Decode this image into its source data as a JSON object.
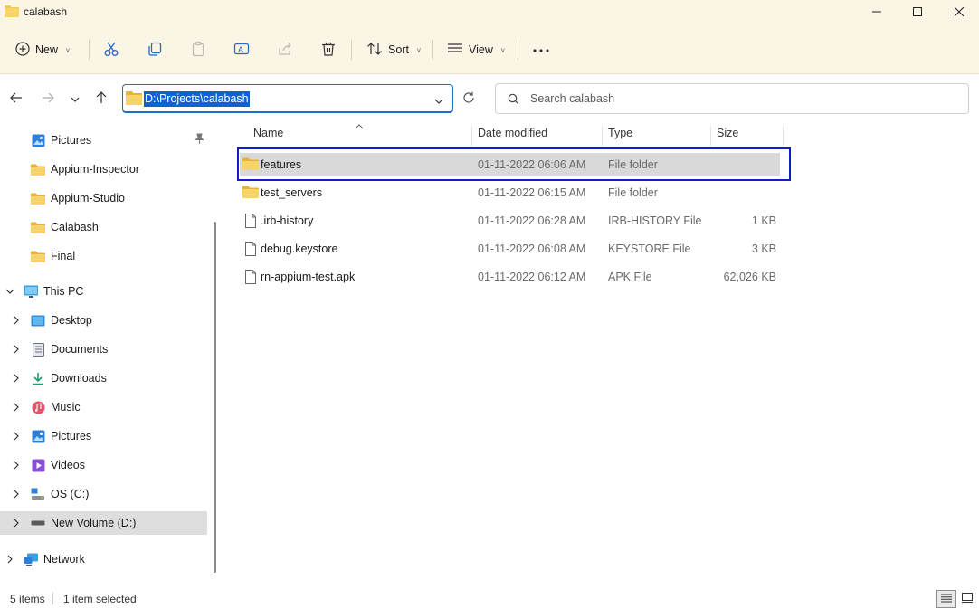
{
  "window": {
    "title": "calabash"
  },
  "toolbar": {
    "new_label": "New",
    "sort_label": "Sort",
    "view_label": "View"
  },
  "address": {
    "path": "D:\\Projects\\calabash"
  },
  "search": {
    "placeholder": "Search calabash"
  },
  "sidebar": {
    "quick_access": [
      "Pictures",
      "Appium-Inspector",
      "Appium-Studio",
      "Calabash",
      "Final"
    ],
    "this_pc": "This PC",
    "this_pc_items": [
      "Desktop",
      "Documents",
      "Downloads",
      "Music",
      "Pictures",
      "Videos",
      "OS (C:)",
      "New Volume (D:)"
    ],
    "network": "Network"
  },
  "columns": {
    "name": "Name",
    "date": "Date modified",
    "type": "Type",
    "size": "Size"
  },
  "files": [
    {
      "name": "features",
      "date": "01-11-2022 06:06 AM",
      "type": "File folder",
      "size": ""
    },
    {
      "name": "test_servers",
      "date": "01-11-2022 06:15 AM",
      "type": "File folder",
      "size": ""
    },
    {
      "name": ".irb-history",
      "date": "01-11-2022 06:28 AM",
      "type": "IRB-HISTORY File",
      "size": "1 KB"
    },
    {
      "name": "debug.keystore",
      "date": "01-11-2022 06:08 AM",
      "type": "KEYSTORE File",
      "size": "3 KB"
    },
    {
      "name": "rn-appium-test.apk",
      "date": "01-11-2022 06:12 AM",
      "type": "APK File",
      "size": "62,026 KB"
    }
  ],
  "status": {
    "item_count": "5 items",
    "selection": "1 item selected"
  },
  "colors": {
    "folder": "#f2c94c",
    "accent": "#0a64d8",
    "highlight_border": "#1020c0",
    "toolbar_bg": "#fbf5e6"
  }
}
